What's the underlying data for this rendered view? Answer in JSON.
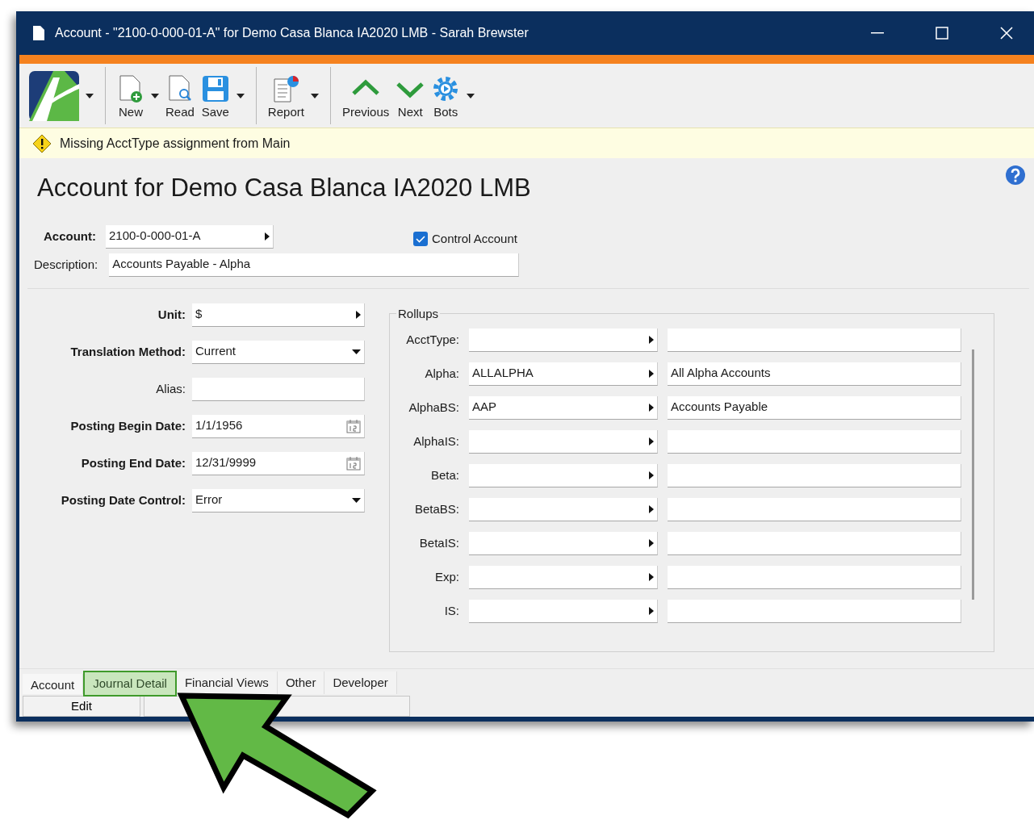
{
  "window": {
    "title": "Account - \"2100-0-000-01-A\" for Demo Casa Blanca IA2020 LMB - Sarah Brewster"
  },
  "toolbar": [
    {
      "kind": "logo",
      "has_menu": true
    },
    {
      "kind": "separator"
    },
    {
      "kind": "new",
      "label": "New",
      "has_menu": true
    },
    {
      "kind": "read",
      "label": "Read",
      "has_menu": false
    },
    {
      "kind": "save",
      "label": "Save",
      "has_menu": true
    },
    {
      "kind": "separator"
    },
    {
      "kind": "report",
      "label": "Report",
      "has_menu": true
    },
    {
      "kind": "separator"
    },
    {
      "kind": "previous",
      "label": "Previous",
      "has_menu": false
    },
    {
      "kind": "next",
      "label": "Next",
      "has_menu": false
    },
    {
      "kind": "bots",
      "label": "Bots",
      "has_menu": true
    }
  ],
  "warning": "Missing AcctType assignment from Main",
  "heading": "Account for Demo Casa Blanca IA2020 LMB",
  "account": {
    "label": "Account:",
    "value": "2100-0-000-01-A"
  },
  "control_account": {
    "label": "Control Account",
    "checked": true
  },
  "description": {
    "label": "Description:",
    "value": "Accounts Payable - Alpha"
  },
  "fields": [
    {
      "label": "Unit:",
      "value": "$",
      "kind": "lookup",
      "required": true
    },
    {
      "label": "Translation Method:",
      "value": "Current",
      "kind": "dropdown",
      "required": true
    },
    {
      "label": "Alias:",
      "kind": "text",
      "required": false
    },
    {
      "label": "Posting Begin Date:",
      "value": "1/1/1956",
      "kind": "date",
      "required": true
    },
    {
      "label": "Posting End Date:",
      "value": "12/31/9999",
      "kind": "date",
      "required": true
    },
    {
      "label": "Posting Date Control:",
      "value": "Error",
      "kind": "dropdown",
      "required": true
    }
  ],
  "rollups": {
    "title": "Rollups",
    "rows": [
      {
        "label": "AcctType:"
      },
      {
        "label": "Alpha:",
        "code": "ALLALPHA",
        "name": "All Alpha Accounts"
      },
      {
        "label": "AlphaBS:",
        "code": "AAP",
        "name": "Accounts Payable"
      },
      {
        "label": "AlphaIS:"
      },
      {
        "label": "Beta:"
      },
      {
        "label": "BetaBS:"
      },
      {
        "label": "BetaIS:"
      },
      {
        "label": "Exp:"
      },
      {
        "label": "IS:"
      }
    ]
  },
  "tabs": [
    {
      "label": "Account",
      "selected": true,
      "highlighted": false
    },
    {
      "label": "Journal Detail",
      "selected": false,
      "highlighted": true
    },
    {
      "label": "Financial Views",
      "selected": false,
      "highlighted": false
    },
    {
      "label": "Other",
      "selected": false,
      "highlighted": false
    },
    {
      "label": "Developer",
      "selected": false,
      "highlighted": false
    }
  ],
  "bottom_buttons": [
    "Edit"
  ]
}
